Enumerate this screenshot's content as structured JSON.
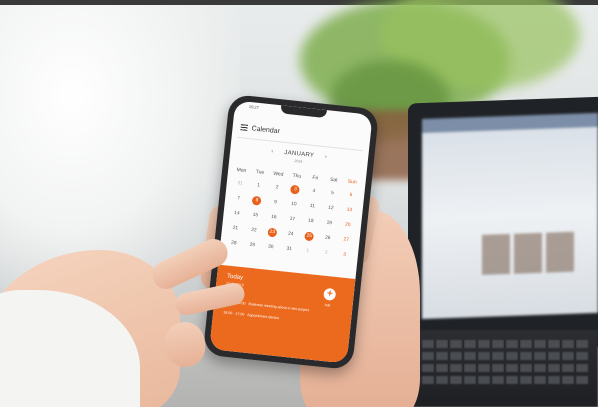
{
  "phone": {
    "status_time": "10:27",
    "app_title": "Calendar",
    "month": "JANUARY",
    "year": "2019",
    "prev": "‹",
    "next": "›",
    "weekdays": [
      "Mon",
      "Tue",
      "Wed",
      "Thu",
      "Fri",
      "Sat",
      "Sun"
    ],
    "days": [
      {
        "t": "31",
        "muted": true
      },
      {
        "t": "1"
      },
      {
        "t": "2"
      },
      {
        "t": "3",
        "marked": true
      },
      {
        "t": "4"
      },
      {
        "t": "5"
      },
      {
        "t": "6",
        "sun": true
      },
      {
        "t": "7"
      },
      {
        "t": "8",
        "marked": true
      },
      {
        "t": "9"
      },
      {
        "t": "10"
      },
      {
        "t": "11"
      },
      {
        "t": "12"
      },
      {
        "t": "13",
        "sun": true
      },
      {
        "t": "14"
      },
      {
        "t": "15"
      },
      {
        "t": "16"
      },
      {
        "t": "17"
      },
      {
        "t": "18"
      },
      {
        "t": "19"
      },
      {
        "t": "20",
        "sun": true
      },
      {
        "t": "21"
      },
      {
        "t": "22"
      },
      {
        "t": "23",
        "marked": true
      },
      {
        "t": "24"
      },
      {
        "t": "25",
        "marked": true
      },
      {
        "t": "26"
      },
      {
        "t": "27",
        "sun": true
      },
      {
        "t": "28"
      },
      {
        "t": "29"
      },
      {
        "t": "30"
      },
      {
        "t": "31"
      },
      {
        "t": "1",
        "muted": true
      },
      {
        "t": "2",
        "muted": true
      },
      {
        "t": "3",
        "muted": true,
        "sun": true
      }
    ],
    "panel": {
      "today_label": "Today",
      "today_date": "28.01.2019",
      "add_label": "Add",
      "events": [
        {
          "time": "12:30 - 13:00",
          "title": "Business meeting about a new project"
        },
        {
          "time": "16:00 - 17:00",
          "title": "Appointment dentist"
        }
      ]
    },
    "accent": "#ec6a1e"
  }
}
